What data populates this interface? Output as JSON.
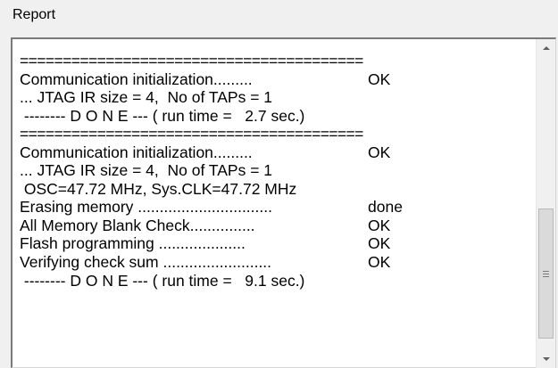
{
  "report": {
    "title": "Report",
    "lines": [
      {
        "text": "========================================",
        "status": ""
      },
      {
        "text": "Communication initialization.........",
        "status": "OK"
      },
      {
        "text": "... JTAG IR size = 4,  No of TAPs = 1",
        "status": ""
      },
      {
        "text": " -------- D O N E --- ( run time =   2.7 sec.)",
        "status": ""
      },
      {
        "text": "========================================",
        "status": ""
      },
      {
        "text": "Communication initialization.........",
        "status": "OK"
      },
      {
        "text": "... JTAG IR size = 4,  No of TAPs = 1",
        "status": ""
      },
      {
        "text": " OSC=47.72 MHz, Sys.CLK=47.72 MHz",
        "status": ""
      },
      {
        "text": "Erasing memory ...............................",
        "status": "done"
      },
      {
        "text": "All Memory Blank Check...............",
        "status": "OK"
      },
      {
        "text": "Flash programming ....................",
        "status": "OK"
      },
      {
        "text": "Verifying check sum .........................",
        "status": "OK"
      },
      {
        "text": " -------- D O N E --- ( run time =   9.1 sec.)",
        "status": ""
      }
    ]
  },
  "scrollbar": {
    "up_icon": "scroll-up-arrow-icon",
    "down_icon": "scroll-down-arrow-icon",
    "thumb_icon": "scroll-grip-icon"
  }
}
